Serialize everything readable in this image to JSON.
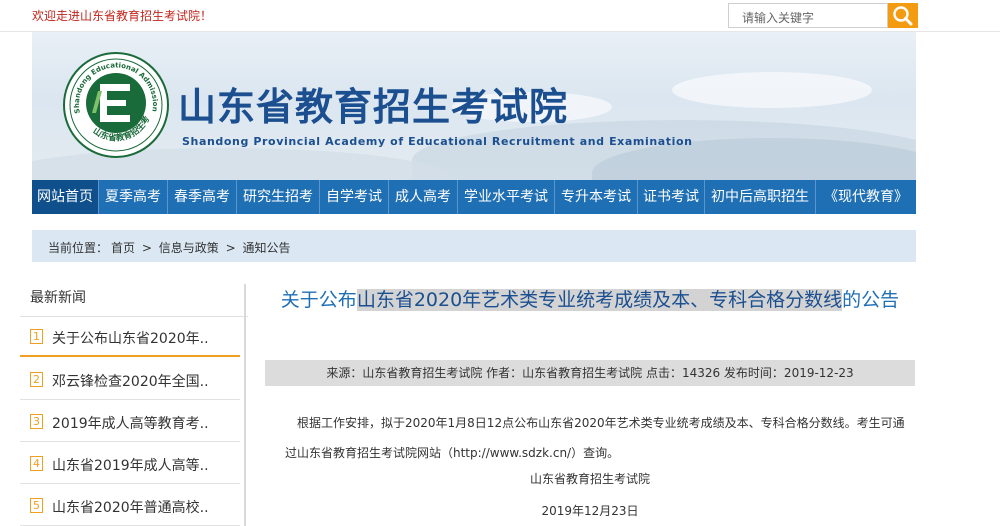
{
  "topbar": {
    "welcome": "欢迎走进山东省教育招生考试院！",
    "search_placeholder": "请输入关键字"
  },
  "header": {
    "title": "山东省教育招生考试院",
    "subtitle": "Shandong Provincial Academy of Educational Recruitment and Examination",
    "seal_ring_text": "Shandong Educational Admission & Examinations",
    "seal_bottom_text": "山东省教育招生考试院"
  },
  "nav": {
    "items": [
      {
        "label": "网站首页",
        "active": true
      },
      {
        "label": "夏季高考"
      },
      {
        "label": "春季高考"
      },
      {
        "label": "研究生招考"
      },
      {
        "label": "自学考试"
      },
      {
        "label": "成人高考"
      },
      {
        "label": "学业水平考试"
      },
      {
        "label": "专升本考试"
      },
      {
        "label": "证书考试"
      },
      {
        "label": "初中后高职招生"
      },
      {
        "label": "《现代教育》"
      }
    ]
  },
  "breadcrumb": {
    "prefix": "当前位置：",
    "items": [
      "首页",
      "信息与政策",
      "通知公告"
    ],
    "separator": ">"
  },
  "sidebar": {
    "title": "最新新闻",
    "items": [
      {
        "num": "1",
        "text": "关于公布山东省2020年.."
      },
      {
        "num": "2",
        "text": "邓云锋检查2020年全国.."
      },
      {
        "num": "3",
        "text": "2019年成人高等教育考.."
      },
      {
        "num": "4",
        "text": "山东省2019年成人高等.."
      },
      {
        "num": "5",
        "text": "山东省2020年普通高校.."
      }
    ]
  },
  "article": {
    "title_pre": "关于公布",
    "title_hl": "山东省2020年艺术类专业统考成绩及本、专科合格分数线",
    "title_post": "的公告",
    "meta": "来源：山东省教育招生考试院 作者：山东省教育招生考试院 点击：14326 发布时间：2019-12-23",
    "body": "根据工作安排，拟于2020年1月8日12点公布山东省2020年艺术类专业统考成绩及本、专科合格分数线。考生可通过山东省教育招生考试院网站（http://www.sdzk.cn/）查询。",
    "signature": "山东省教育招生考试院",
    "date": "2019年12月23日"
  },
  "colors": {
    "nav_blue": "#1f6fb5",
    "nav_active": "#0e4f8c",
    "accent_orange": "#f39c12",
    "title_blue": "#1b4f90",
    "welcome_red": "#c0271e"
  }
}
